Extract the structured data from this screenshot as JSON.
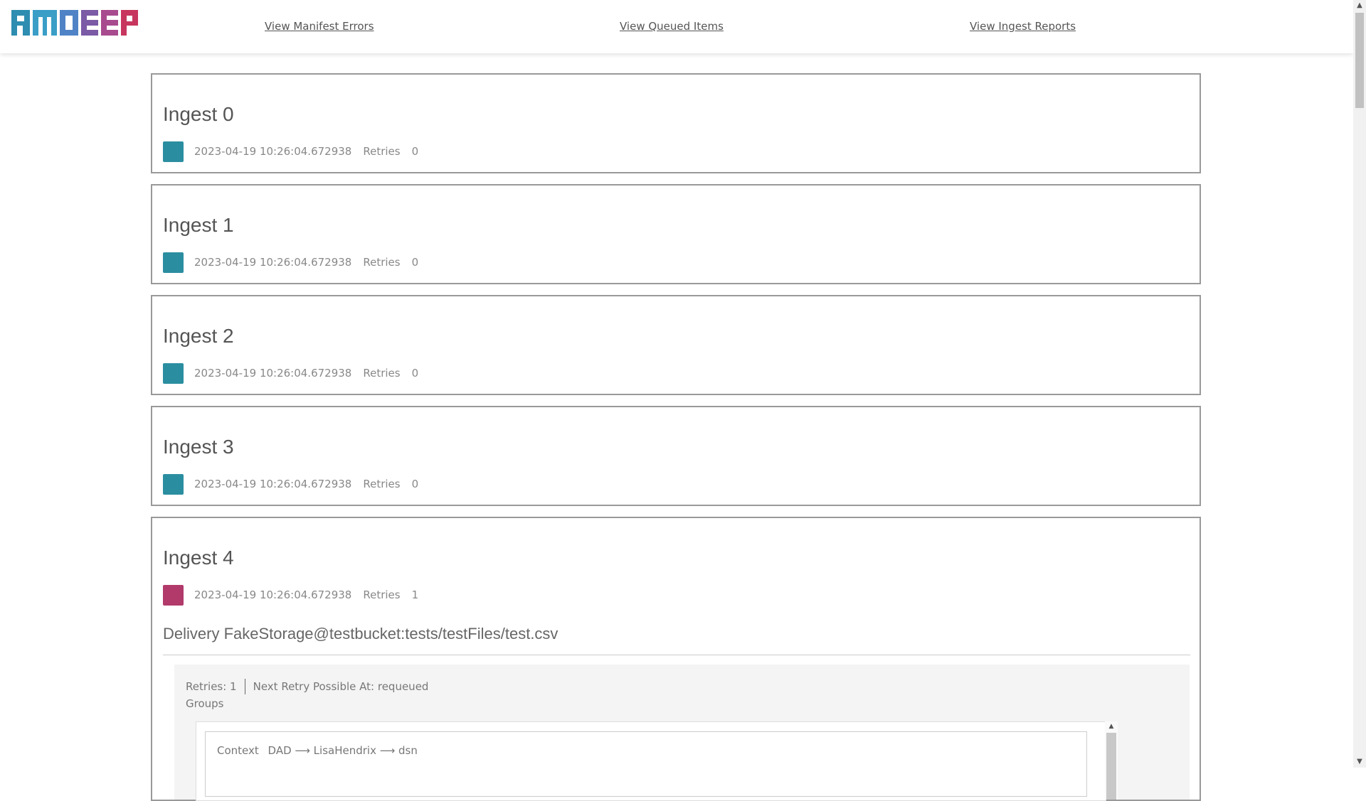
{
  "header": {
    "logo_text": "RMDEEP",
    "nav": [
      {
        "label": "View Manifest Errors"
      },
      {
        "label": "View Queued Items"
      },
      {
        "label": "View Ingest Reports"
      }
    ]
  },
  "colors": {
    "ok": "#2b8ea0",
    "error": "#b13a6b"
  },
  "ingests": [
    {
      "title": "Ingest 0",
      "timestamp": "2023-04-19 10:26:04.672938",
      "retries_label": "Retries",
      "retries": "0",
      "status": "ok"
    },
    {
      "title": "Ingest 1",
      "timestamp": "2023-04-19 10:26:04.672938",
      "retries_label": "Retries",
      "retries": "0",
      "status": "ok"
    },
    {
      "title": "Ingest 2",
      "timestamp": "2023-04-19 10:26:04.672938",
      "retries_label": "Retries",
      "retries": "0",
      "status": "ok"
    },
    {
      "title": "Ingest 3",
      "timestamp": "2023-04-19 10:26:04.672938",
      "retries_label": "Retries",
      "retries": "0",
      "status": "ok"
    },
    {
      "title": "Ingest 4",
      "timestamp": "2023-04-19 10:26:04.672938",
      "retries_label": "Retries",
      "retries": "1",
      "status": "error"
    }
  ],
  "delivery": {
    "title": "Delivery FakeStorage@testbucket:tests/testFiles/test.csv",
    "retries_text": "Retries: 1",
    "next_retry_text": "Next Retry Possible At: requeued",
    "groups_label": "Groups",
    "context_label": "Context",
    "context_path": "DAD ⟶ LisaHendrix ⟶ dsn"
  }
}
